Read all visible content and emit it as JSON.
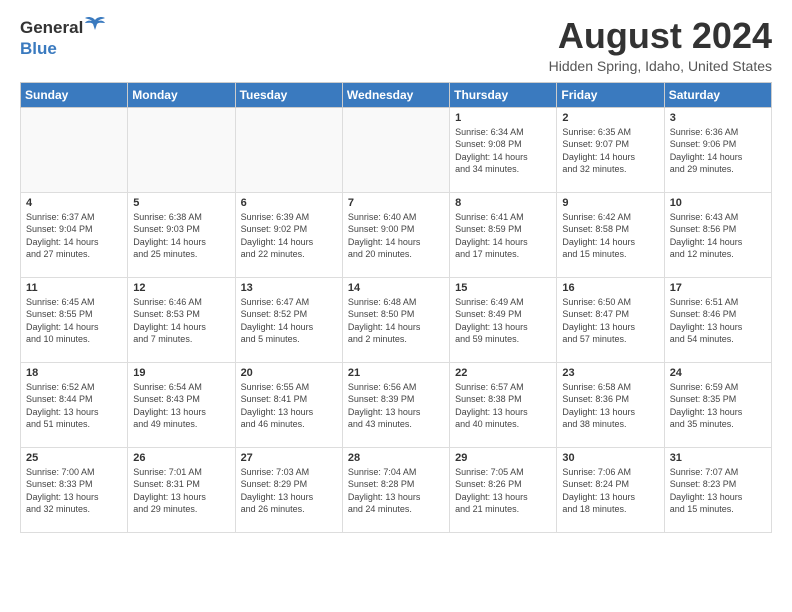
{
  "logo": {
    "general": "General",
    "blue": "Blue"
  },
  "title": "August 2024",
  "location": "Hidden Spring, Idaho, United States",
  "weekdays": [
    "Sunday",
    "Monday",
    "Tuesday",
    "Wednesday",
    "Thursday",
    "Friday",
    "Saturday"
  ],
  "weeks": [
    [
      {
        "day": "",
        "info": ""
      },
      {
        "day": "",
        "info": ""
      },
      {
        "day": "",
        "info": ""
      },
      {
        "day": "",
        "info": ""
      },
      {
        "day": "1",
        "info": "Sunrise: 6:34 AM\nSunset: 9:08 PM\nDaylight: 14 hours\nand 34 minutes."
      },
      {
        "day": "2",
        "info": "Sunrise: 6:35 AM\nSunset: 9:07 PM\nDaylight: 14 hours\nand 32 minutes."
      },
      {
        "day": "3",
        "info": "Sunrise: 6:36 AM\nSunset: 9:06 PM\nDaylight: 14 hours\nand 29 minutes."
      }
    ],
    [
      {
        "day": "4",
        "info": "Sunrise: 6:37 AM\nSunset: 9:04 PM\nDaylight: 14 hours\nand 27 minutes."
      },
      {
        "day": "5",
        "info": "Sunrise: 6:38 AM\nSunset: 9:03 PM\nDaylight: 14 hours\nand 25 minutes."
      },
      {
        "day": "6",
        "info": "Sunrise: 6:39 AM\nSunset: 9:02 PM\nDaylight: 14 hours\nand 22 minutes."
      },
      {
        "day": "7",
        "info": "Sunrise: 6:40 AM\nSunset: 9:00 PM\nDaylight: 14 hours\nand 20 minutes."
      },
      {
        "day": "8",
        "info": "Sunrise: 6:41 AM\nSunset: 8:59 PM\nDaylight: 14 hours\nand 17 minutes."
      },
      {
        "day": "9",
        "info": "Sunrise: 6:42 AM\nSunset: 8:58 PM\nDaylight: 14 hours\nand 15 minutes."
      },
      {
        "day": "10",
        "info": "Sunrise: 6:43 AM\nSunset: 8:56 PM\nDaylight: 14 hours\nand 12 minutes."
      }
    ],
    [
      {
        "day": "11",
        "info": "Sunrise: 6:45 AM\nSunset: 8:55 PM\nDaylight: 14 hours\nand 10 minutes."
      },
      {
        "day": "12",
        "info": "Sunrise: 6:46 AM\nSunset: 8:53 PM\nDaylight: 14 hours\nand 7 minutes."
      },
      {
        "day": "13",
        "info": "Sunrise: 6:47 AM\nSunset: 8:52 PM\nDaylight: 14 hours\nand 5 minutes."
      },
      {
        "day": "14",
        "info": "Sunrise: 6:48 AM\nSunset: 8:50 PM\nDaylight: 14 hours\nand 2 minutes."
      },
      {
        "day": "15",
        "info": "Sunrise: 6:49 AM\nSunset: 8:49 PM\nDaylight: 13 hours\nand 59 minutes."
      },
      {
        "day": "16",
        "info": "Sunrise: 6:50 AM\nSunset: 8:47 PM\nDaylight: 13 hours\nand 57 minutes."
      },
      {
        "day": "17",
        "info": "Sunrise: 6:51 AM\nSunset: 8:46 PM\nDaylight: 13 hours\nand 54 minutes."
      }
    ],
    [
      {
        "day": "18",
        "info": "Sunrise: 6:52 AM\nSunset: 8:44 PM\nDaylight: 13 hours\nand 51 minutes."
      },
      {
        "day": "19",
        "info": "Sunrise: 6:54 AM\nSunset: 8:43 PM\nDaylight: 13 hours\nand 49 minutes."
      },
      {
        "day": "20",
        "info": "Sunrise: 6:55 AM\nSunset: 8:41 PM\nDaylight: 13 hours\nand 46 minutes."
      },
      {
        "day": "21",
        "info": "Sunrise: 6:56 AM\nSunset: 8:39 PM\nDaylight: 13 hours\nand 43 minutes."
      },
      {
        "day": "22",
        "info": "Sunrise: 6:57 AM\nSunset: 8:38 PM\nDaylight: 13 hours\nand 40 minutes."
      },
      {
        "day": "23",
        "info": "Sunrise: 6:58 AM\nSunset: 8:36 PM\nDaylight: 13 hours\nand 38 minutes."
      },
      {
        "day": "24",
        "info": "Sunrise: 6:59 AM\nSunset: 8:35 PM\nDaylight: 13 hours\nand 35 minutes."
      }
    ],
    [
      {
        "day": "25",
        "info": "Sunrise: 7:00 AM\nSunset: 8:33 PM\nDaylight: 13 hours\nand 32 minutes."
      },
      {
        "day": "26",
        "info": "Sunrise: 7:01 AM\nSunset: 8:31 PM\nDaylight: 13 hours\nand 29 minutes."
      },
      {
        "day": "27",
        "info": "Sunrise: 7:03 AM\nSunset: 8:29 PM\nDaylight: 13 hours\nand 26 minutes."
      },
      {
        "day": "28",
        "info": "Sunrise: 7:04 AM\nSunset: 8:28 PM\nDaylight: 13 hours\nand 24 minutes."
      },
      {
        "day": "29",
        "info": "Sunrise: 7:05 AM\nSunset: 8:26 PM\nDaylight: 13 hours\nand 21 minutes."
      },
      {
        "day": "30",
        "info": "Sunrise: 7:06 AM\nSunset: 8:24 PM\nDaylight: 13 hours\nand 18 minutes."
      },
      {
        "day": "31",
        "info": "Sunrise: 7:07 AM\nSunset: 8:23 PM\nDaylight: 13 hours\nand 15 minutes."
      }
    ]
  ]
}
